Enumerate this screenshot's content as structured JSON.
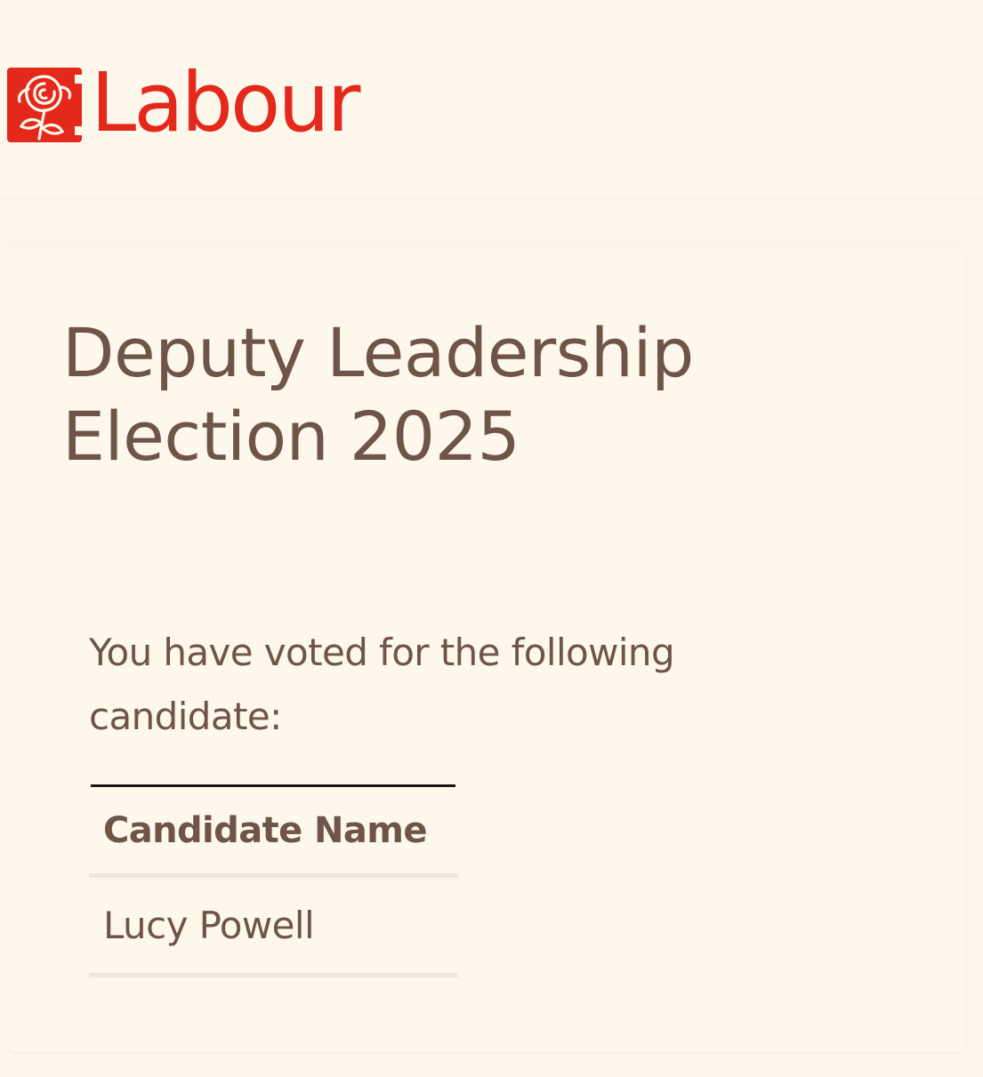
{
  "colors": {
    "background": "#fef7ec",
    "brand_red": "#e4281b",
    "text_brown": "#6e5548"
  },
  "brand": {
    "logo_icon": "labour-rose-icon",
    "name": "Labour"
  },
  "election": {
    "title": "Deputy Leadership Election 2025"
  },
  "confirmation": {
    "intro": "You have voted for the following candidate:"
  },
  "vote_table": {
    "header": "Candidate Name",
    "rows": [
      "Lucy Powell"
    ]
  }
}
